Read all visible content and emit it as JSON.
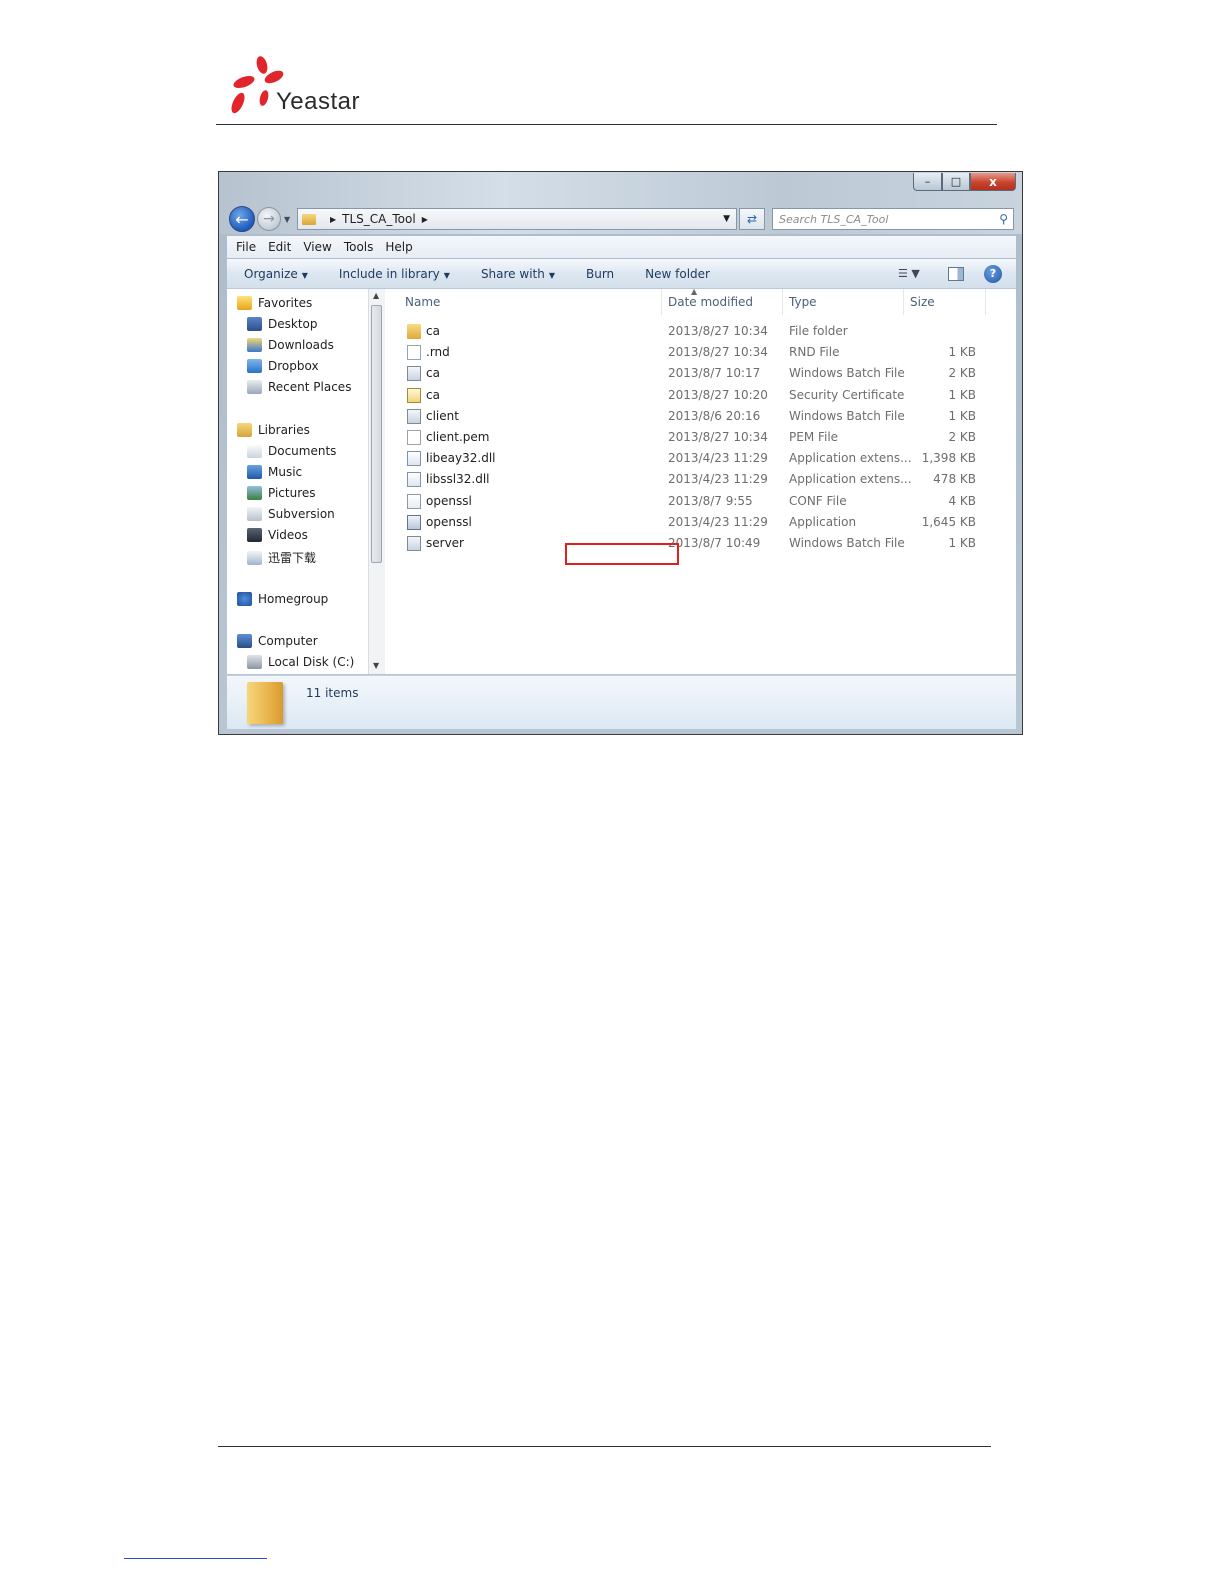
{
  "doc": {
    "logo_text": "Yeastar"
  },
  "window": {
    "caption": {
      "minimize": "–",
      "maximize": "□",
      "close": "x"
    },
    "address": {
      "path": "TLS_CA_Tool"
    },
    "search": {
      "placeholder": "Search TLS_CA_Tool"
    },
    "menu": [
      "File",
      "Edit",
      "View",
      "Tools",
      "Help"
    ],
    "toolbar": [
      "Organize",
      "Include in library",
      "Share with",
      "Burn",
      "New folder"
    ],
    "nav": [
      {
        "label": "Favorites",
        "icon": "star-icon",
        "level": 0
      },
      {
        "label": "Desktop",
        "icon": "desktop-icon",
        "level": 1
      },
      {
        "label": "Downloads",
        "icon": "downloads-icon",
        "level": 1
      },
      {
        "label": "Dropbox",
        "icon": "dropbox-icon",
        "level": 1
      },
      {
        "label": "Recent Places",
        "icon": "recent-places-icon",
        "level": 1
      },
      {
        "label": "Libraries",
        "icon": "libraries-icon",
        "level": 0
      },
      {
        "label": "Documents",
        "icon": "documents-icon",
        "level": 1
      },
      {
        "label": "Music",
        "icon": "music-icon",
        "level": 1
      },
      {
        "label": "Pictures",
        "icon": "pictures-icon",
        "level": 1
      },
      {
        "label": "Subversion",
        "icon": "subversion-icon",
        "level": 1
      },
      {
        "label": "Videos",
        "icon": "videos-icon",
        "level": 1
      },
      {
        "label": "迅雷下载",
        "icon": "thunder-download-icon",
        "level": 1
      },
      {
        "label": "Homegroup",
        "icon": "homegroup-icon",
        "level": 0
      },
      {
        "label": "Computer",
        "icon": "computer-icon",
        "level": 0
      },
      {
        "label": "Local Disk (C:)",
        "icon": "local-disk-icon",
        "level": 1
      }
    ],
    "columns": [
      "Name",
      "Date modified",
      "Type",
      "Size"
    ],
    "files": [
      {
        "name": "ca",
        "date": "2013/8/27 10:34",
        "type": "File folder",
        "size": "",
        "icon": "folder"
      },
      {
        "name": ".rnd",
        "date": "2013/8/27 10:34",
        "type": "RND File",
        "size": "1 KB",
        "icon": "file"
      },
      {
        "name": "ca",
        "date": "2013/8/7 10:17",
        "type": "Windows Batch File",
        "size": "2 KB",
        "icon": "bat"
      },
      {
        "name": "ca",
        "date": "2013/8/27 10:20",
        "type": "Security Certificate",
        "size": "1 KB",
        "icon": "cert"
      },
      {
        "name": "client",
        "date": "2013/8/6 20:16",
        "type": "Windows Batch File",
        "size": "1 KB",
        "icon": "bat"
      },
      {
        "name": "client.pem",
        "date": "2013/8/27 10:34",
        "type": "PEM File",
        "size": "2 KB",
        "icon": "file"
      },
      {
        "name": "libeay32.dll",
        "date": "2013/4/23 11:29",
        "type": "Application extens...",
        "size": "1,398 KB",
        "icon": "dll"
      },
      {
        "name": "libssl32.dll",
        "date": "2013/4/23 11:29",
        "type": "Application extens...",
        "size": "478 KB",
        "icon": "dll"
      },
      {
        "name": "openssl",
        "date": "2013/8/7 9:55",
        "type": "CONF File",
        "size": "4 KB",
        "icon": "conf"
      },
      {
        "name": "openssl",
        "date": "2013/4/23 11:29",
        "type": "Application",
        "size": "1,645 KB",
        "icon": "app"
      },
      {
        "name": "server",
        "date": "2013/8/7 10:49",
        "type": "Windows Batch File",
        "size": "1 KB",
        "icon": "bat"
      }
    ],
    "status": {
      "count": "11 items"
    },
    "colors": {
      "highlight": "#e0201b",
      "accent": "#1d5bbd"
    }
  }
}
